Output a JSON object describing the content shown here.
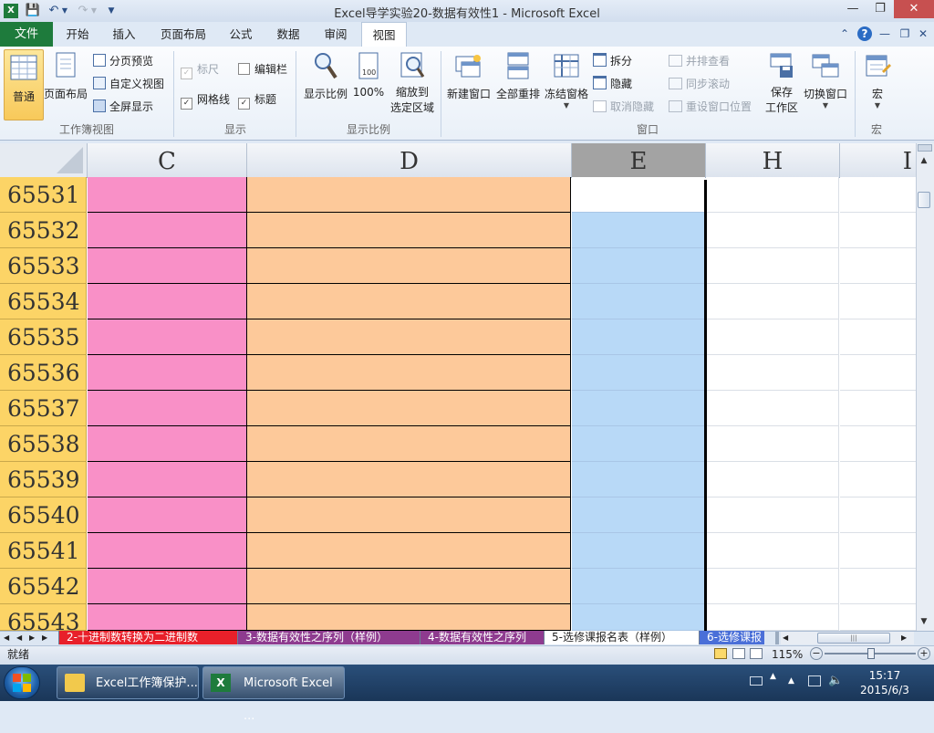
{
  "title": "Excel导学实验20-数据有效性1  -  Microsoft Excel",
  "tabs": {
    "file": "文件",
    "home": "开始",
    "insert": "插入",
    "page_layout": "页面布局",
    "formulas": "公式",
    "data": "数据",
    "review": "审阅",
    "view": "视图"
  },
  "ribbon": {
    "workbook_views": {
      "label": "工作簿视图",
      "normal": "普通",
      "page_layout": "页面布局",
      "page_break_preview": "分页预览",
      "custom_views": "自定义视图",
      "full_screen": "全屏显示"
    },
    "show": {
      "label": "显示",
      "ruler": "标尺",
      "formula_bar": "编辑栏",
      "gridlines": "网格线",
      "headings": "标题"
    },
    "zoom": {
      "label": "显示比例",
      "zoom_btn": "显示比例",
      "hundred": "100%",
      "zoom_sel_1": "缩放到",
      "zoom_sel_2": "选定区域"
    },
    "window": {
      "label": "窗口",
      "new_window": "新建窗口",
      "arrange_all": "全部重排",
      "freeze_panes": "冻结窗格",
      "split": "拆分",
      "hide": "隐藏",
      "unhide": "取消隐藏",
      "side_by_side": "并排查看",
      "sync_scroll": "同步滚动",
      "reset_pos": "重设窗口位置",
      "save_ws_1": "保存",
      "save_ws_2": "工作区",
      "switch_windows": "切换窗口"
    },
    "macros": {
      "label": "宏",
      "macros_btn": "宏"
    }
  },
  "columns": [
    "C",
    "D",
    "E",
    "H",
    "I"
  ],
  "rows": [
    "65531",
    "65532",
    "65533",
    "65534",
    "65535",
    "65536",
    "65537",
    "65538",
    "65539",
    "65540",
    "65541",
    "65542",
    "65543"
  ],
  "sheets": [
    {
      "name": "2-十进制数转换为二进制数",
      "color": "#e8202a",
      "active": false
    },
    {
      "name": "3-数据有效性之序列（样例）",
      "color": "#8e3b8f",
      "active": false
    },
    {
      "name": "4-数据有效性之序列",
      "color": "#8e3b8f",
      "active": false
    },
    {
      "name": "5-选修课报名表（样例）",
      "color": "#ffffff",
      "active": true
    },
    {
      "name": "6-选修课报",
      "color": "#4a6fd8",
      "active": false
    }
  ],
  "status": {
    "ready": "就绪",
    "zoom": "115%"
  },
  "taskbar": {
    "items": [
      "Excel工作簿保护...",
      "Microsoft Excel ..."
    ],
    "time": "15:17",
    "date": "2015/6/3"
  }
}
